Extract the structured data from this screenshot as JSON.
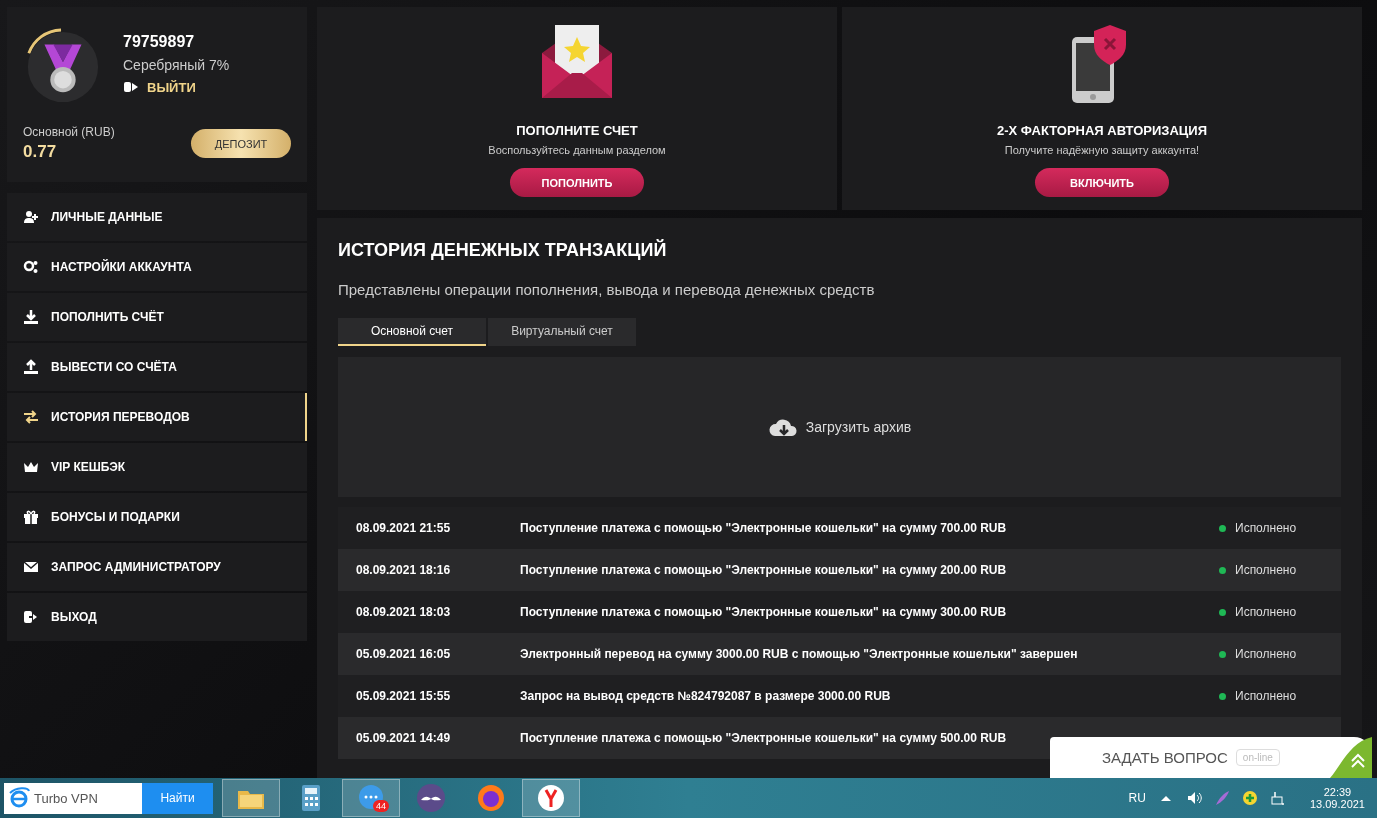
{
  "profile": {
    "user_id": "79759897",
    "level_name": "Серебряный 7%",
    "logout": "ВЫЙТИ",
    "balance_label": "Основной (RUB)",
    "balance": "0.77",
    "deposit_button": "ДЕПОЗИТ"
  },
  "sidebar": {
    "items": [
      {
        "label": "ЛИЧНЫЕ ДАННЫЕ",
        "kind": "profile",
        "selected": false
      },
      {
        "label": "НАСТРОЙКИ АККАУНТА",
        "kind": "settings",
        "selected": false
      },
      {
        "label": "ПОПОЛНИТЬ СЧЁТ",
        "kind": "deposit",
        "selected": false
      },
      {
        "label": "ВЫВЕСТИ СО СЧЁТА",
        "kind": "withdraw",
        "selected": false
      },
      {
        "label": "ИСТОРИЯ ПЕРЕВОДОВ",
        "kind": "history",
        "selected": true
      },
      {
        "label": "VIP КЕШБЭК",
        "kind": "vip",
        "selected": false
      },
      {
        "label": "БОНУСЫ И ПОДАРКИ",
        "kind": "bonus",
        "selected": false
      },
      {
        "label": "ЗАПРОС АДМИНИСТРАТОРУ",
        "kind": "support",
        "selected": false
      },
      {
        "label": "ВЫХОД",
        "kind": "exit",
        "selected": false
      }
    ]
  },
  "promo_cards": [
    {
      "kind": "envelope",
      "title": "ПОПОЛНИТЕ СЧЕТ",
      "subtitle": "Воспользуйтесь данным разделом",
      "button": "ПОПОЛНИТЬ"
    },
    {
      "kind": "phone",
      "title": "2-Х ФАКТОРНАЯ АВТОРИЗАЦИЯ",
      "subtitle": "Получите надёжную защиту аккаунта!",
      "button": "ВКЛЮЧИТЬ"
    }
  ],
  "history": {
    "title": "ИСТОРИЯ ДЕНЕЖНЫХ ТРАНЗАКЦИЙ",
    "subtitle": "Представлены операции пополнения, вывода и перевода денежных средств",
    "tabs": [
      {
        "label": "Основной счет",
        "selected": true
      },
      {
        "label": "Виртуальный счет",
        "selected": false
      }
    ],
    "archive_button": "Загрузить архив",
    "rows": [
      {
        "date": "08.09.2021 21:55",
        "description": "Поступление платежа с помощью \"Электронные кошельки\" на сумму 700.00 RUB",
        "status": "Исполнено",
        "color": "#1fb855"
      },
      {
        "date": "08.09.2021 18:16",
        "description": "Поступление платежа с помощью \"Электронные кошельки\" на сумму 200.00 RUB",
        "status": "Исполнено",
        "color": "#1fb855"
      },
      {
        "date": "08.09.2021 18:03",
        "description": "Поступление платежа с помощью \"Электронные кошельки\" на сумму 300.00 RUB",
        "status": "Исполнено",
        "color": "#1fb855"
      },
      {
        "date": "05.09.2021 16:05",
        "description": "Электронный перевод на сумму 3000.00 RUB с помощью \"Электронные кошельки\" завершен",
        "status": "Исполнено",
        "color": "#1fb855"
      },
      {
        "date": "05.09.2021 15:55",
        "description": "Запрос на вывод средств №824792087 в размере 3000.00 RUB",
        "status": "Исполнено",
        "color": "#1fb855"
      },
      {
        "date": "05.09.2021 14:49",
        "description": "Поступление платежа с помощью \"Электронные кошельки\" на сумму 500.00 RUB"
      }
    ]
  },
  "chat_widget": {
    "label": "ЗАДАТЬ ВОПРОС",
    "badge": "on-line"
  },
  "taskbar": {
    "search_value": "Turbo VPN",
    "search_button": "Найти",
    "apps": [
      {
        "kind": "folder",
        "selected": true
      },
      {
        "kind": "calculator",
        "selected": false
      },
      {
        "kind": "chat",
        "badge": "44",
        "selected": true
      },
      {
        "kind": "mustache",
        "selected": false
      },
      {
        "kind": "firefox",
        "selected": false
      },
      {
        "kind": "yandex",
        "selected": true
      }
    ],
    "language": "RU",
    "time": "22:39",
    "date": "13.09.2021"
  }
}
